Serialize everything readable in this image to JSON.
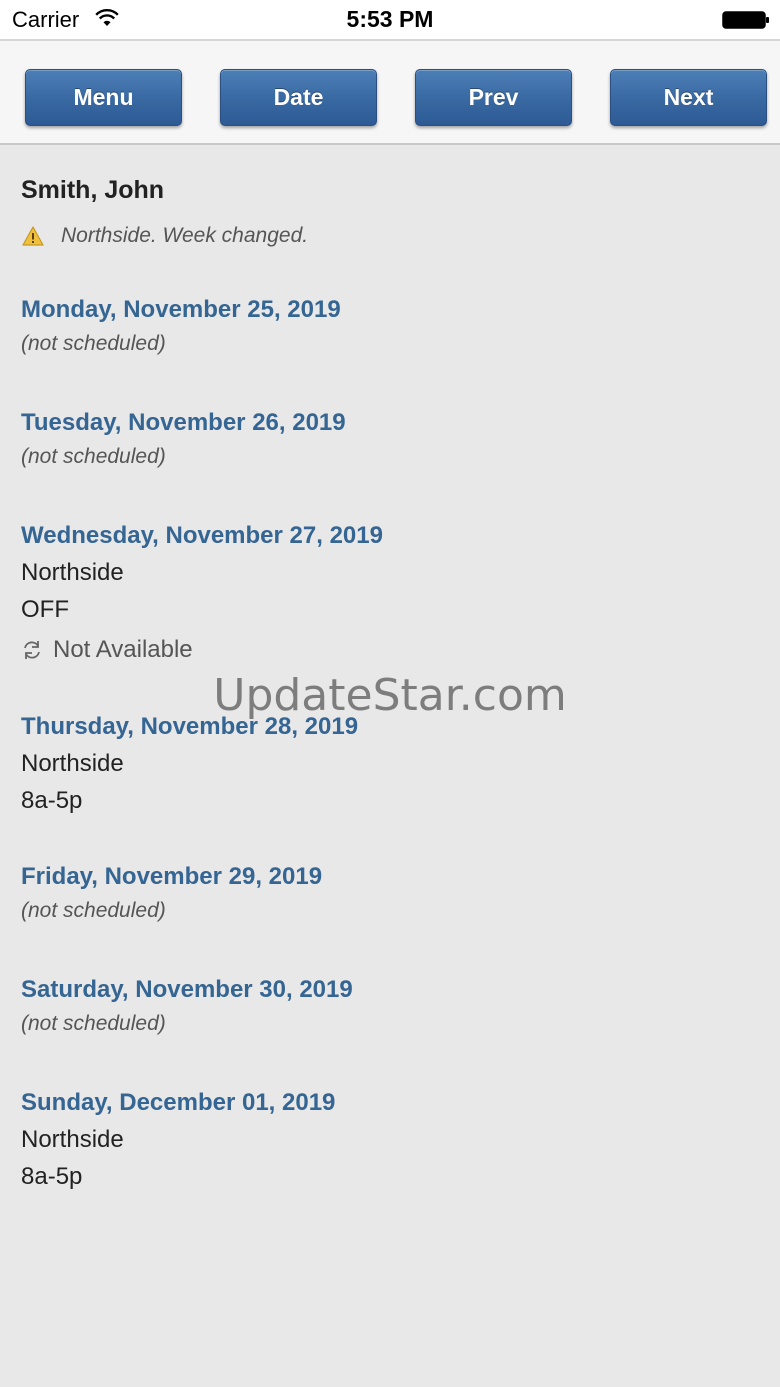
{
  "status_bar": {
    "carrier": "Carrier",
    "time": "5:53 PM"
  },
  "toolbar": {
    "menu_label": "Menu",
    "date_label": "Date",
    "prev_label": "Prev",
    "next_label": "Next"
  },
  "employee": {
    "name": "Smith, John",
    "notice": "Northside. Week changed."
  },
  "days": [
    {
      "date": "Monday, November 25, 2019",
      "status": "(not scheduled)"
    },
    {
      "date": "Tuesday, November 26, 2019",
      "status": "(not scheduled)"
    },
    {
      "date": "Wednesday, November 27, 2019",
      "location": "Northside",
      "shift": "OFF",
      "availability": "Not Available"
    },
    {
      "date": "Thursday, November 28, 2019",
      "location": "Northside",
      "shift": "8a-5p"
    },
    {
      "date": "Friday, November 29, 2019",
      "status": "(not scheduled)"
    },
    {
      "date": "Saturday, November 30, 2019",
      "status": "(not scheduled)"
    },
    {
      "date": "Sunday, December 01, 2019",
      "location": "Northside",
      "shift": "8a-5p"
    }
  ],
  "watermark": "UpdateStar.com",
  "colors": {
    "accent": "#356593",
    "button": "#3a6aa3",
    "background": "#e8e8e8"
  }
}
